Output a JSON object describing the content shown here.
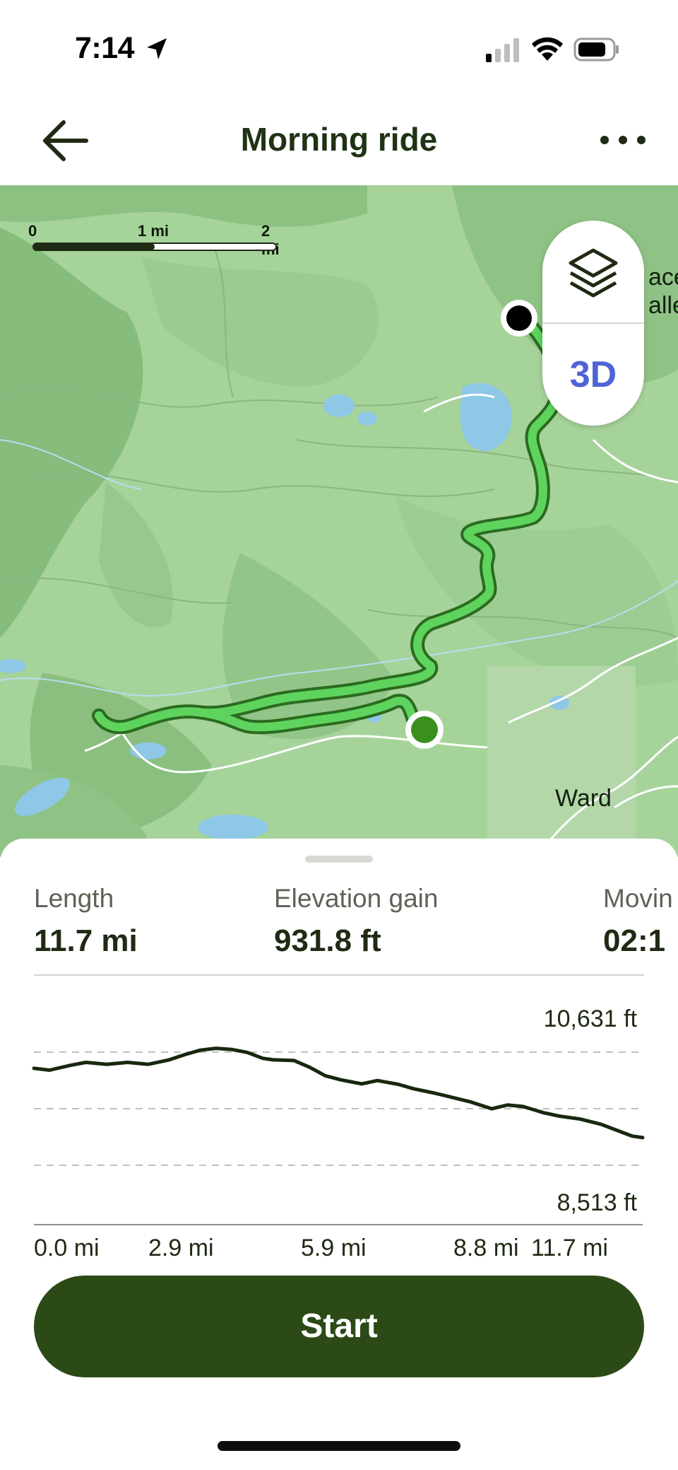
{
  "status_bar": {
    "time": "7:14"
  },
  "header": {
    "title": "Morning ride"
  },
  "map": {
    "scale_labels": [
      "0",
      "1 mi",
      "2 mi"
    ],
    "layer_button_icon": "layers-icon",
    "three_d_label": "3D",
    "place_labels": {
      "ward": "Ward",
      "partial_top": "ace\nalle"
    },
    "route_color": "#5ed45e",
    "start_marker_color": "#3a8f1f",
    "end_marker_color": "#000000"
  },
  "stats": [
    {
      "label": "Length",
      "value": "11.7 mi"
    },
    {
      "label": "Elevation gain",
      "value": "931.8 ft"
    },
    {
      "label": "Movin",
      "value": "02:1"
    }
  ],
  "chart_data": {
    "type": "line",
    "title": "",
    "xlabel": "",
    "ylabel": "",
    "x_tick_labels": [
      "0.0 mi",
      "2.9 mi",
      "5.9 mi",
      "8.8 mi",
      "11.7 mi"
    ],
    "y_labels": {
      "max": "10,631 ft",
      "min": "8,513 ft"
    },
    "ylim": [
      8513,
      10631
    ],
    "xlim": [
      0,
      11.7
    ],
    "grid": "horizontal dashed",
    "series": [
      {
        "x": [
          0,
          0.3,
          0.7,
          1.0,
          1.4,
          1.8,
          2.2,
          2.6,
          2.9,
          3.2,
          3.5,
          3.8,
          4.1,
          4.4,
          4.6,
          5.0,
          5.3,
          5.6,
          5.9,
          6.3,
          6.6,
          7.0,
          7.3,
          7.7,
          8.0,
          8.4,
          8.8,
          9.1,
          9.4,
          9.8,
          10.1,
          10.5,
          10.9,
          11.2,
          11.5,
          11.7
        ],
        "y": [
          10355,
          10330,
          10395,
          10435,
          10410,
          10435,
          10410,
          10470,
          10540,
          10600,
          10625,
          10610,
          10570,
          10490,
          10470,
          10460,
          10370,
          10255,
          10200,
          10145,
          10190,
          10140,
          10080,
          10020,
          9970,
          9900,
          9810,
          9860,
          9840,
          9755,
          9710,
          9670,
          9600,
          9520,
          9440,
          9420
        ]
      }
    ]
  },
  "start_button": {
    "label": "Start"
  }
}
